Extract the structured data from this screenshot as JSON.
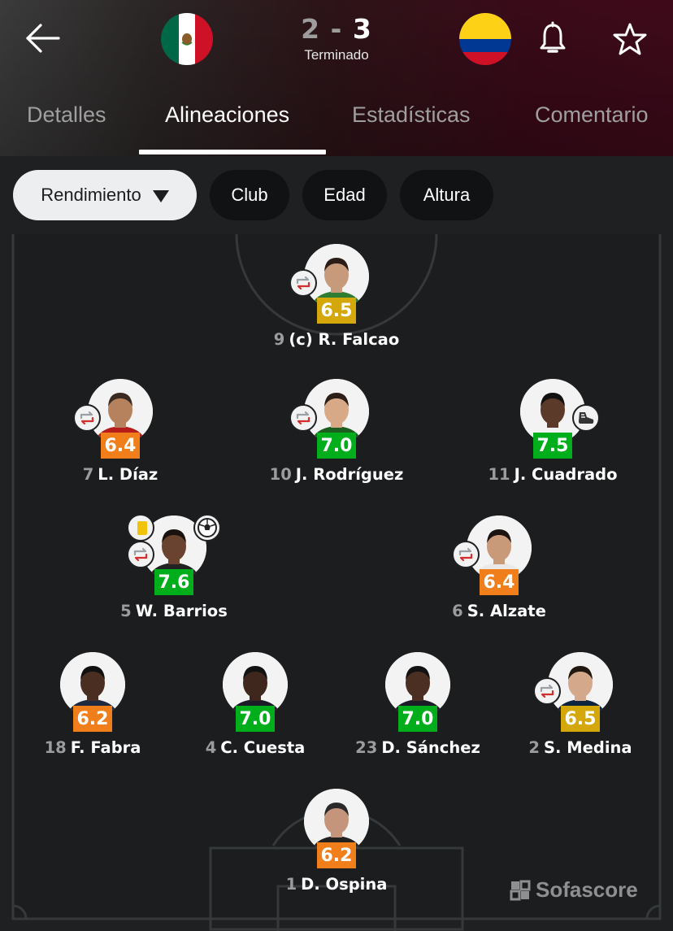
{
  "header": {
    "home_score": "2",
    "separator": "-",
    "away_score": "3",
    "status": "Terminado",
    "home_flag": "mexico-flag-icon",
    "away_flag": "colombia-flag-icon"
  },
  "tabs": [
    {
      "label": "Detalles",
      "active": false
    },
    {
      "label": "Alineaciones",
      "active": true
    },
    {
      "label": "Estadísticas",
      "active": false
    },
    {
      "label": "Comentario",
      "active": false
    }
  ],
  "filters": {
    "selected": "Rendimiento",
    "options": [
      "Club",
      "Edad",
      "Altura"
    ]
  },
  "players": [
    {
      "number": "9",
      "name": "(c) R. Falcao",
      "rating": "6.5",
      "rating_color": "#d4a80a"
    },
    {
      "number": "7",
      "name": "L. Díaz",
      "rating": "6.4",
      "rating_color": "#f07f1b"
    },
    {
      "number": "10",
      "name": "J. Rodríguez",
      "rating": "7.0",
      "rating_color": "#00ad1a"
    },
    {
      "number": "11",
      "name": "J. Cuadrado",
      "rating": "7.5",
      "rating_color": "#00ad1a"
    },
    {
      "number": "5",
      "name": "W. Barrios",
      "rating": "7.6",
      "rating_color": "#00ad1a"
    },
    {
      "number": "6",
      "name": "S. Alzate",
      "rating": "6.4",
      "rating_color": "#f07f1b"
    },
    {
      "number": "18",
      "name": "F. Fabra",
      "rating": "6.2",
      "rating_color": "#f07f1b"
    },
    {
      "number": "4",
      "name": "C. Cuesta",
      "rating": "7.0",
      "rating_color": "#00ad1a"
    },
    {
      "number": "23",
      "name": "D. Sánchez",
      "rating": "7.0",
      "rating_color": "#00ad1a"
    },
    {
      "number": "2",
      "name": "S. Medina",
      "rating": "6.5",
      "rating_color": "#d4a80a"
    },
    {
      "number": "1",
      "name": "D. Ospina",
      "rating": "6.2",
      "rating_color": "#f07f1b"
    }
  ],
  "watermark": "Sofascore",
  "colors": {
    "green": "#00ad1a",
    "orange": "#f07f1b",
    "yellow": "#d4a80a"
  }
}
